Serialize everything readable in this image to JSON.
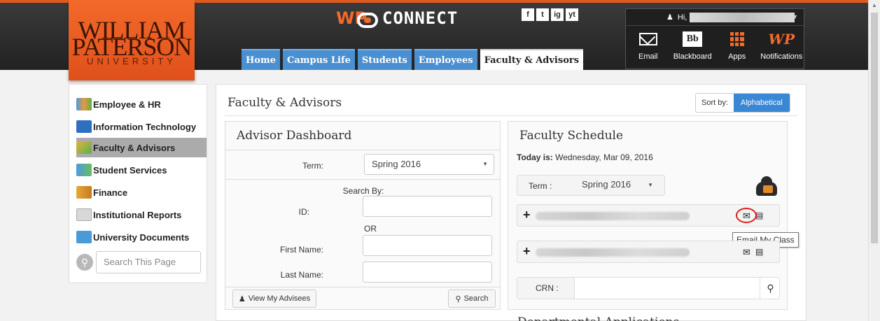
{
  "header": {
    "logo": {
      "line1": "WILLIAM",
      "line2": "PATERSON",
      "line3": "UNIVERSITY"
    },
    "brand": {
      "prefix": "WP",
      "name": "CONNECT"
    },
    "social": [
      "f",
      "t",
      "ig",
      "yt"
    ],
    "tabs": [
      {
        "label": "Home",
        "active": false
      },
      {
        "label": "Campus Life",
        "active": false
      },
      {
        "label": "Students",
        "active": false
      },
      {
        "label": "Employees",
        "active": false
      },
      {
        "label": "Faculty & Advisors",
        "active": true
      }
    ],
    "user": {
      "greeting": "Hi,",
      "apps": [
        {
          "label": "Email",
          "icon": "envelope-icon"
        },
        {
          "label": "Blackboard",
          "icon": "blackboard-icon",
          "glyph": "Bb"
        },
        {
          "label": "Apps",
          "icon": "apps-grid-icon"
        },
        {
          "label": "Notifications",
          "icon": "wp-notifications-icon",
          "glyph": "WP"
        }
      ]
    }
  },
  "sidebar": {
    "items": [
      {
        "label": "Employee & HR",
        "icon": "people-icon",
        "active": false
      },
      {
        "label": "Information Technology",
        "icon": "monitor-icon",
        "active": false
      },
      {
        "label": "Faculty & Advisors",
        "icon": "pencil-ruler-icon",
        "active": true
      },
      {
        "label": "Student Services",
        "icon": "students-icon",
        "active": false
      },
      {
        "label": "Finance",
        "icon": "finance-icon",
        "active": false
      },
      {
        "label": "Institutional Reports",
        "icon": "report-icon",
        "active": false
      },
      {
        "label": "University Documents",
        "icon": "folder-icon",
        "active": false
      }
    ],
    "search_placeholder": "Search This Page"
  },
  "main": {
    "title": "Faculty & Advisors",
    "sort_label": "Sort by:",
    "sort_value": "Alphabetical",
    "advisor": {
      "title": "Advisor Dashboard",
      "term_label": "Term:",
      "term_value": "Spring 2016",
      "search_by": "Search By:",
      "id_label": "ID:",
      "or_label": "OR",
      "first_name_label": "First Name:",
      "last_name_label": "Last Name:",
      "view_button": "View My Advisees",
      "search_button": "Search"
    },
    "schedule": {
      "title": "Faculty Schedule",
      "today_label": "Today is:",
      "today_value": "Wednesday, Mar 09, 2016",
      "term_label": "Term :",
      "term_value": "Spring 2016",
      "tooltip": "Email My Class",
      "crn_label": "CRN :"
    },
    "partial_below": "Departmental Applications"
  },
  "colors": {
    "accent": "#3a87d6",
    "brand_orange": "#f26a2a",
    "highlight": "#e01b1b"
  }
}
